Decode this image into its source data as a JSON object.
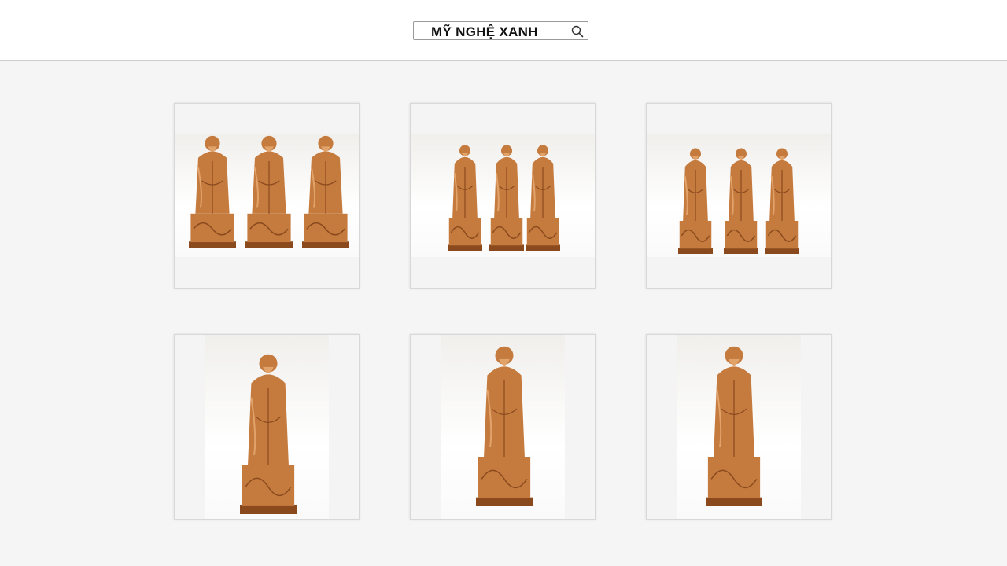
{
  "header": {
    "search": {
      "text": "MỸ NGHỆ XANH",
      "icon": "search-icon"
    }
  },
  "gallery": {
    "items": [
      {
        "subject": "three-statues-group"
      },
      {
        "subject": "three-statues-group"
      },
      {
        "subject": "three-statues-group"
      },
      {
        "subject": "single-statue"
      },
      {
        "subject": "single-statue"
      },
      {
        "subject": "single-statue"
      }
    ]
  },
  "colors": {
    "page_background": "#f5f5f5",
    "header_background": "#ffffff",
    "wood": "#c57a3e",
    "wood_dark": "#8a4a1e",
    "wood_light": "#e2a36a"
  }
}
